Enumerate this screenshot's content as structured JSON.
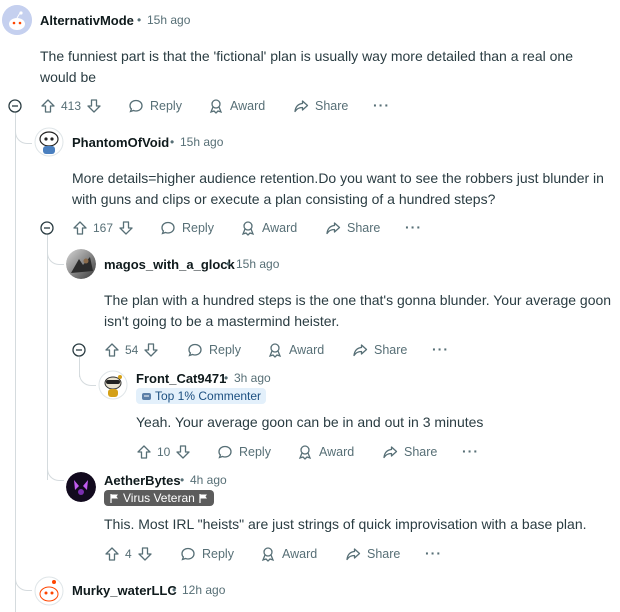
{
  "comments": [
    {
      "username": "AlternativMode",
      "dot": "•",
      "time": "15h ago",
      "body": "The funniest part is that the 'fictional' plan is usually way more detailed than a real one would be",
      "votes": "413"
    },
    {
      "username": "PhantomOfVoid",
      "dot": "•",
      "time": "15h ago",
      "body": "More details=higher audience retention.Do you want to see the robbers just blunder in with guns and clips or execute a plan consisting of a hundred steps?",
      "votes": "167"
    },
    {
      "username": "magos_with_a_glock",
      "dot": "•",
      "time": "15h ago",
      "body": "The plan with a hundred steps is the one that's gonna blunder. Your average goon isn't going to be a mastermind heister.",
      "votes": "54"
    },
    {
      "username": "Front_Cat9471",
      "dot": "•",
      "time": "3h ago",
      "flair": "Top 1% Commenter",
      "body": "Yeah. Your average goon can be in and out in 3 minutes",
      "votes": "10"
    },
    {
      "username": "AetherBytes",
      "dot": "•",
      "time": "4h ago",
      "flair": "Virus Veteran",
      "body": "This. Most IRL \"heists\" are just strings of quick improvisation with a base plan.",
      "votes": "4"
    },
    {
      "username": "Murky_waterLLC",
      "dot": "•",
      "time": "12h ago"
    }
  ],
  "actions": {
    "reply": "Reply",
    "award": "Award",
    "share": "Share",
    "more": "···"
  },
  "colors": {
    "text": "#0f1a1c",
    "meta": "#576f76",
    "thread_line": "#d5dbde",
    "flair_blue_bg": "#e3f0fb",
    "flair_dark_bg": "#5c5c5c"
  },
  "icons": [
    "upvote-icon",
    "downvote-icon",
    "reply-icon",
    "award-icon",
    "share-icon",
    "collapse-icon",
    "more-icon",
    "flag-icon"
  ]
}
